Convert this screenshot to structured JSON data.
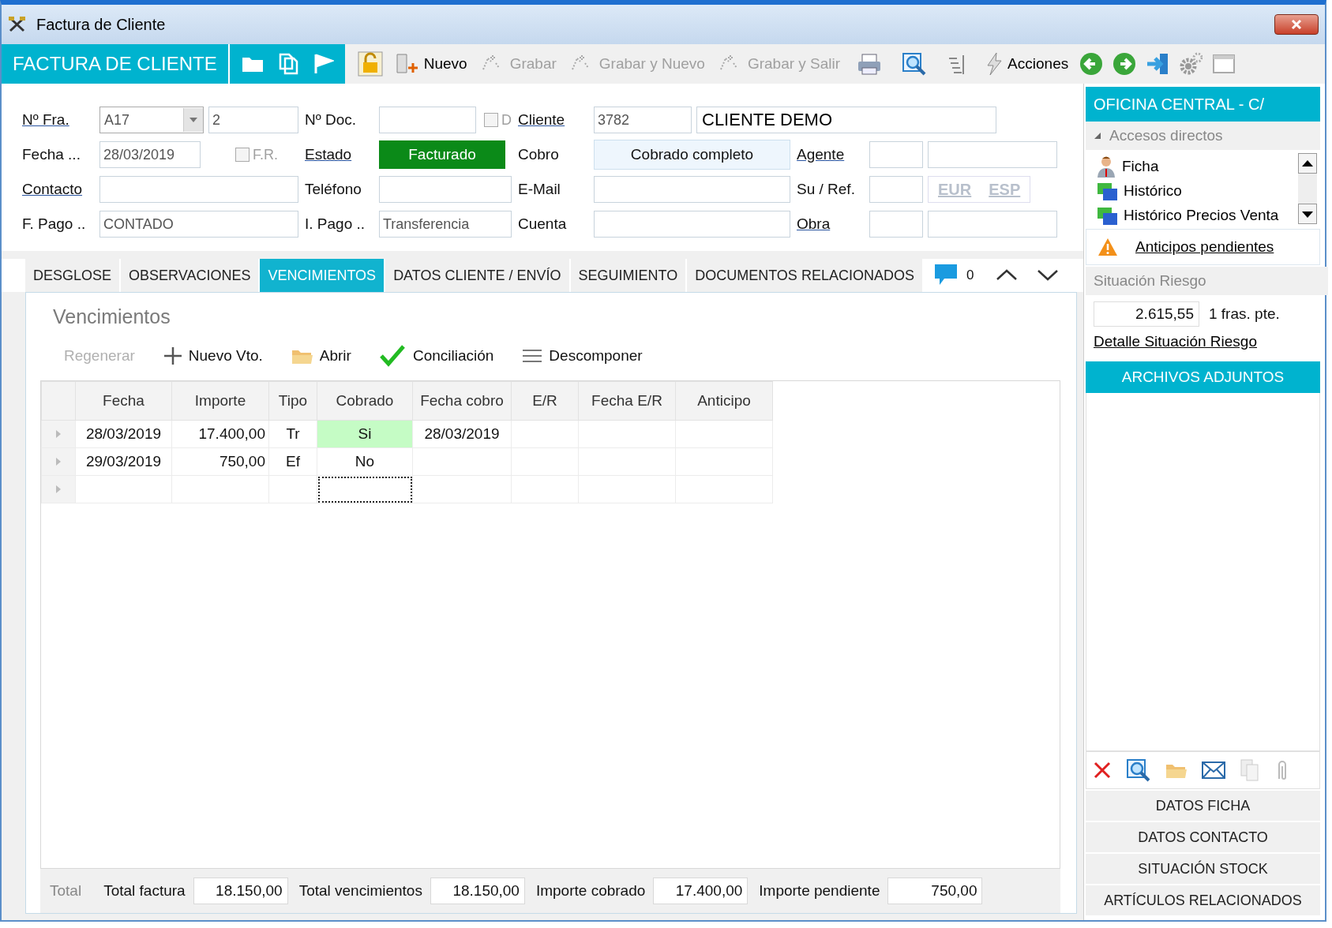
{
  "window": {
    "title": "Factura de Cliente"
  },
  "header": {
    "title": "FACTURA DE CLIENTE"
  },
  "toolbar": {
    "buttons": [
      {
        "label": "Nuevo",
        "disabled": false
      },
      {
        "label": "Grabar",
        "disabled": true
      },
      {
        "label": "Grabar y Nuevo",
        "disabled": true
      },
      {
        "label": "Grabar y Salir",
        "disabled": true
      }
    ],
    "actions": {
      "label": "Acciones",
      "disabled": false
    }
  },
  "form": {
    "rows": [
      [
        {
          "label": "Nº Fra.",
          "link": true,
          "controls": [
            {
              "kind": "select",
              "value": "A17"
            },
            {
              "kind": "field",
              "value": "2"
            }
          ]
        },
        {
          "label": "Nº Doc.",
          "link": false,
          "controls": [
            {
              "kind": "field"
            },
            {
              "kind": "check",
              "text": "D",
              "checked": false
            }
          ]
        },
        {
          "label": "Cliente",
          "link": true,
          "controls": [
            {
              "kind": "field",
              "value": "3782"
            },
            {
              "kind": "display",
              "value": "CLIENTE DEMO"
            }
          ]
        }
      ],
      [
        {
          "label": "Fecha ...",
          "link": false,
          "controls": [
            {
              "kind": "field",
              "value": "28/03/2019"
            },
            {
              "kind": "check",
              "text": "F.R.",
              "checked": false
            }
          ]
        },
        {
          "label": "Estado",
          "link": true,
          "controls": [
            {
              "kind": "status",
              "text": "Facturado"
            }
          ]
        },
        {
          "label": "Cobro",
          "link": false,
          "controls": [
            {
              "kind": "info",
              "text": "Cobrado completo"
            }
          ]
        },
        {
          "label": "Agente",
          "link": true,
          "controls": [
            {
              "kind": "field"
            },
            {
              "kind": "field"
            }
          ]
        }
      ],
      [
        {
          "label": "Contacto",
          "link": true,
          "controls": [
            {
              "kind": "field"
            }
          ]
        },
        {
          "label": "Teléfono",
          "link": false,
          "controls": [
            {
              "kind": "field"
            }
          ]
        },
        {
          "label": "E-Mail",
          "link": false,
          "controls": [
            {
              "kind": "field"
            }
          ]
        },
        {
          "label": "Su / Ref.",
          "link": false,
          "controls": [
            {
              "kind": "field"
            },
            {
              "kind": "currency",
              "options": [
                "EUR",
                "ESP"
              ]
            }
          ]
        }
      ],
      [
        {
          "label": "F. Pago ..",
          "link": false,
          "controls": [
            {
              "kind": "field",
              "value": "CONTADO"
            }
          ]
        },
        {
          "label": "I. Pago ..",
          "link": false,
          "controls": [
            {
              "kind": "field",
              "value": "Transferencia"
            }
          ]
        },
        {
          "label": "Cuenta",
          "link": false,
          "controls": [
            {
              "kind": "field"
            }
          ]
        },
        {
          "label": "Obra",
          "link": true,
          "controls": [
            {
              "kind": "field"
            },
            {
              "kind": "field"
            }
          ]
        }
      ]
    ]
  },
  "tabs": [
    {
      "label": "DESGLOSE",
      "selected": false
    },
    {
      "label": "OBSERVACIONES",
      "selected": false
    },
    {
      "label": "VENCIMIENTOS",
      "selected": true
    },
    {
      "label": "DATOS CLIENTE / ENVÍO",
      "selected": false
    },
    {
      "label": "SEGUIMIENTO",
      "selected": false
    },
    {
      "label": "DOCUMENTOS RELACIONADOS",
      "selected": false
    }
  ],
  "comments": {
    "count": "0"
  },
  "vencimientos": {
    "title": "Vencimientos",
    "actions": [
      {
        "label": "Regenerar",
        "kind": "regen",
        "disabled": true
      },
      {
        "label": "Nuevo Vto.",
        "kind": "add",
        "disabled": false
      },
      {
        "label": "Abrir",
        "kind": "open",
        "disabled": false
      },
      {
        "label": "Conciliación",
        "kind": "check",
        "disabled": false
      },
      {
        "label": "Descomponer",
        "kind": "split",
        "disabled": false
      }
    ],
    "table": {
      "columns": [
        {
          "label": "Fecha",
          "kind": "date"
        },
        {
          "label": "Importe",
          "kind": "amount"
        },
        {
          "label": "Tipo",
          "kind": "text"
        },
        {
          "label": "Cobrado",
          "kind": "status"
        },
        {
          "label": "Fecha cobro",
          "kind": "date"
        },
        {
          "label": "E/R",
          "kind": "text"
        },
        {
          "label": "Fecha E/R",
          "kind": "date"
        },
        {
          "label": "Anticipo",
          "kind": "text"
        }
      ],
      "rows": [
        {
          "cells": [
            "28/03/2019",
            "17.400,00",
            "Tr",
            "Si",
            "28/03/2019"
          ],
          "paid": true,
          "focused": false
        },
        {
          "cells": [
            "29/03/2019",
            "750,00",
            "Ef",
            "No"
          ],
          "paid": false,
          "focused": false
        },
        {
          "cells": [],
          "paid": false,
          "focused": true
        }
      ]
    },
    "totals": {
      "label": "Total",
      "items": [
        {
          "label": "Total factura",
          "value": "18.150,00"
        },
        {
          "label": "Total vencimientos",
          "value": "18.150,00"
        },
        {
          "label": "Importe cobrado",
          "value": "17.400,00"
        },
        {
          "label": "Importe pendiente",
          "value": "750,00"
        }
      ]
    }
  },
  "sidebar": {
    "title": "OFICINA CENTRAL - C/",
    "shortcuts": {
      "label": "Accesos directos",
      "expanded": true,
      "items": [
        {
          "label": "Ficha",
          "kind": "person"
        },
        {
          "label": "Histórico",
          "kind": "folders"
        },
        {
          "label": "Histórico Precios Venta",
          "kind": "folders"
        }
      ]
    },
    "alert": "Anticipos pendientes",
    "risk": {
      "title": "Situación Riesgo",
      "value": "2.615,55",
      "note": "1 fras. pte.",
      "link": "Detalle Situación Riesgo"
    },
    "attachments": {
      "title": "ARCHIVOS ADJUNTOS"
    },
    "buttons": [
      "DATOS FICHA",
      "DATOS CONTACTO",
      "SITUACIÓN STOCK",
      "ARTÍCULOS RELACIONADOS"
    ]
  }
}
